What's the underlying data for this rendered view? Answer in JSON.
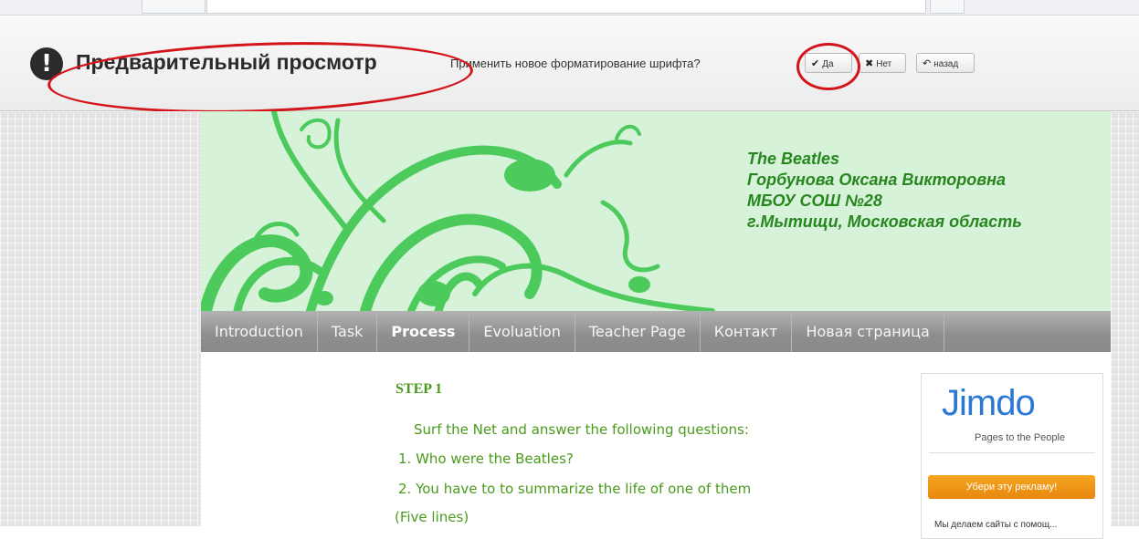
{
  "preview_bar": {
    "icon_glyph": "!",
    "title": "Предварительный просмотр",
    "question": "Применить новое форматирование шрифта?",
    "yes_label": "Да",
    "no_label": "Нет",
    "back_label": "назад",
    "yes_icon": "✔",
    "no_icon": "✖",
    "back_icon": "↶"
  },
  "site": {
    "header_lines": [
      "The Beatles",
      "Горбунова Оксана Викторовна",
      "МБОУ СОШ №28",
      "г.Мытищи, Московская область"
    ],
    "nav": [
      {
        "label": "Introduction",
        "active": false
      },
      {
        "label": "Task",
        "active": false
      },
      {
        "label": "Process",
        "active": true
      },
      {
        "label": "Evoluation",
        "active": false
      },
      {
        "label": "Teacher Page",
        "active": false
      },
      {
        "label": "Контакт",
        "active": false
      },
      {
        "label": "Новая страница",
        "active": false
      }
    ],
    "content": {
      "heading": "STEP 1",
      "lines": [
        "Surf the Net and answer the following questions:",
        "1. Who were the Beatles?",
        "2. You have to to summarize the life of one of them",
        "(Five lines)"
      ]
    },
    "sidebar": {
      "logo": "Jimdo",
      "tagline": "Pages to the People",
      "ad_button": "Убери эту рекламу!",
      "cut_text": "Мы делаем сайты с помощ..."
    }
  },
  "colors": {
    "header_bg": "#d6f2d9",
    "header_text": "#27871e",
    "vine": "#4ccb5c",
    "content_text": "#4a9b1c",
    "highlight": "#d4141b",
    "ad_button": "#f29a1a",
    "jimdo_blue": "#2b78d4"
  }
}
